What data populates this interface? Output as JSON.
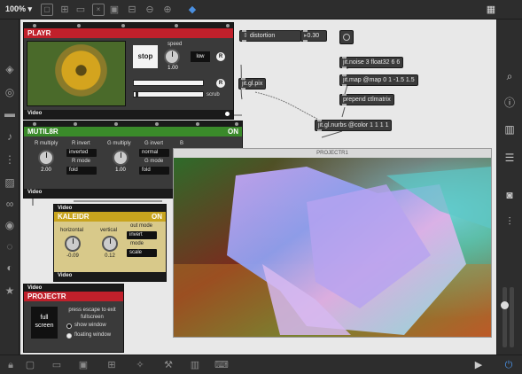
{
  "toolbar": {
    "zoom": "100%",
    "zoom_caret": "▾"
  },
  "playr": {
    "title": "PLAYR",
    "stop_label": "stop",
    "speed_label": "speed",
    "speed_value": "1.00",
    "loop_label": "low",
    "r_label": "R",
    "scrub_label": "scrub",
    "footer": "Video"
  },
  "mutil8r": {
    "title": "MUTIL8R",
    "status": "ON",
    "r_multiply_label": "R multiply",
    "r_multiply_value": "2.00",
    "r_invert_label": "R invert",
    "r_invert_value": "inverted",
    "r_mode_label": "R mode",
    "r_mode_value": "fold",
    "g_multiply_label": "G multiply",
    "g_multiply_value": "1.00",
    "g_invert_label": "G invert",
    "g_invert_value": "normal",
    "g_mode_label": "G mode",
    "g_mode_value": "fold",
    "b_label": "B",
    "footer": "Video"
  },
  "kaleidr": {
    "header_left": "Video",
    "title": "KALEIDR",
    "status": "ON",
    "horizontal_label": "horizontal",
    "horizontal_value": "-0.09",
    "vertical_label": "vertical",
    "vertical_value": "0.12",
    "out_mode_label": "out mode",
    "out_mode_value": "invert",
    "mode_label": "mode",
    "mode_value": "scale",
    "footer": "Video"
  },
  "projectr": {
    "header_left": "Video",
    "title": "PROJECTR",
    "fullscreen_label": "full screen",
    "hint": "press escape to exit fullscreen",
    "show_window": "show window",
    "floating_window": "floating window"
  },
  "objects": {
    "distortion": "distortion",
    "float_value": "0.30",
    "noise": "jit.noise 3 float32 6 6",
    "map": "jit.map @map 0 1 -1.5 1.5",
    "prepend": "prepend ctlmatrix",
    "nurbs": "jit.gl.nurbs @color 1 1 1 1",
    "pix": "jit.gl.pix"
  },
  "window": {
    "title": "PROJECTR1"
  },
  "colors": {
    "red_header": "#c0202b",
    "green_header": "#3a8a2a",
    "yellow_header": "#c8a41e",
    "canvas": "#e8e8e8"
  }
}
